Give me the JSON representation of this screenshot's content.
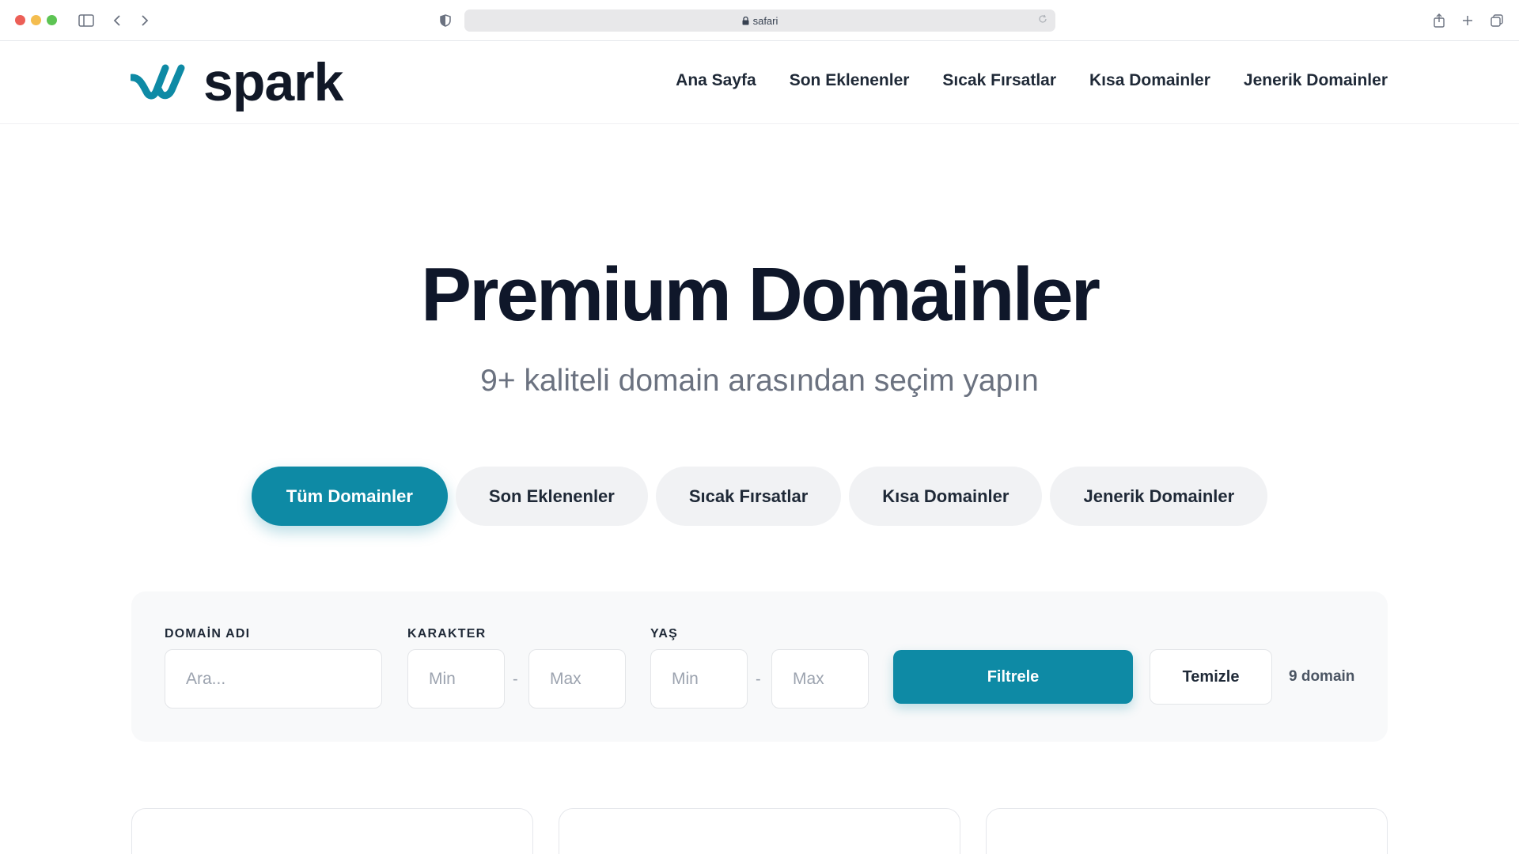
{
  "browser": {
    "url": "safari"
  },
  "header": {
    "logo_text": "spark",
    "nav": [
      "Ana Sayfa",
      "Son Eklenenler",
      "Sıcak Fırsatlar",
      "Kısa Domainler",
      "Jenerik Domainler"
    ]
  },
  "hero": {
    "title": "Premium Domainler",
    "subtitle": "9+ kaliteli domain arasından seçim yapın"
  },
  "tabs": [
    {
      "label": "Tüm Domainler",
      "active": true
    },
    {
      "label": "Son Eklenenler",
      "active": false
    },
    {
      "label": "Sıcak Fırsatlar",
      "active": false
    },
    {
      "label": "Kısa Domainler",
      "active": false
    },
    {
      "label": "Jenerik Domainler",
      "active": false
    }
  ],
  "filter": {
    "domain_label": "DOMAİN ADI",
    "domain_placeholder": "Ara...",
    "char_label": "KARAKTER",
    "char_min_placeholder": "Min",
    "char_max_placeholder": "Max",
    "age_label": "YAŞ",
    "age_min_placeholder": "Min",
    "age_max_placeholder": "Max",
    "dash": "-",
    "filter_button": "Filtrele",
    "clear_button": "Temizle",
    "count": "9 domain"
  },
  "colors": {
    "accent": "#0e8aa5",
    "text_dark": "#111827",
    "muted": "#6b7280"
  }
}
